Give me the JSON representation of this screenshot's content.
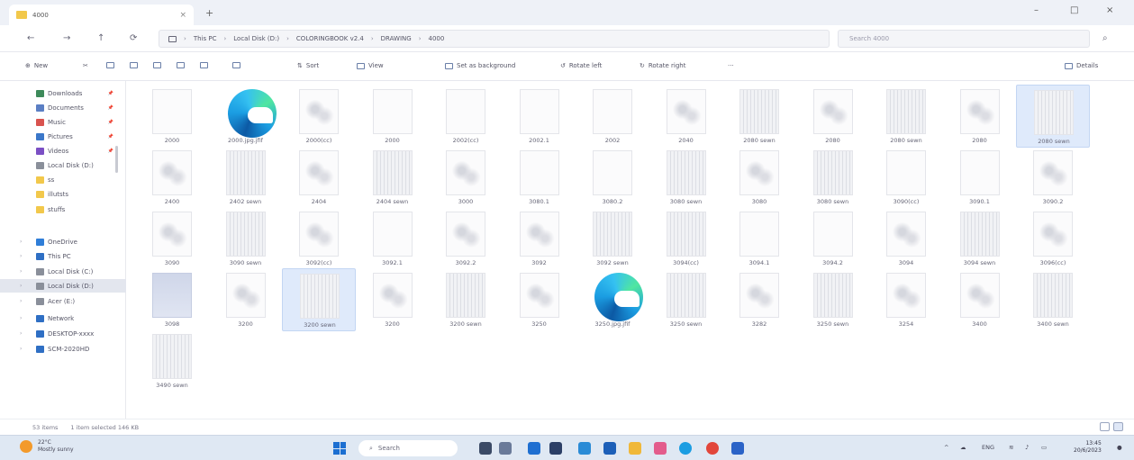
{
  "tab": {
    "title": "4000",
    "close": "×",
    "new": "+"
  },
  "window_controls": {
    "minimize": "–",
    "maximize": "□",
    "close": "×"
  },
  "nav": {
    "back": "←",
    "forward": "→",
    "up": "↑",
    "refresh": "⟳"
  },
  "address": {
    "crumbs": [
      "This PC",
      "Local Disk (D:)",
      "COLORINGBOOK v2.4",
      "DRAWING",
      "4000"
    ],
    "separator": "›"
  },
  "search": {
    "placeholder": "Search 4000"
  },
  "commands": {
    "new": "New",
    "sort": "Sort",
    "view": "View",
    "set_background": "Set as background",
    "rotate_left": "Rotate left",
    "rotate_right": "Rotate right",
    "more": "···",
    "details": "Details"
  },
  "sidebar": {
    "items": [
      {
        "label": "Downloads",
        "pinned": true,
        "color": "#3d8a5a"
      },
      {
        "label": "Documents",
        "pinned": true,
        "color": "#5b7fc4"
      },
      {
        "label": "Music",
        "pinned": true,
        "color": "#d9534f"
      },
      {
        "label": "Pictures",
        "pinned": true,
        "color": "#3b77c9"
      },
      {
        "label": "Videos",
        "pinned": true,
        "color": "#7b4fc4"
      },
      {
        "label": "Local Disk (D:)",
        "pinned": false,
        "color": "#8a8f9a"
      },
      {
        "label": "ss",
        "pinned": false,
        "color": "#f2c84b"
      },
      {
        "label": "illutsts",
        "pinned": false,
        "color": "#f2c84b"
      },
      {
        "label": "stuffs",
        "pinned": false,
        "color": "#f2c84b"
      },
      {
        "label": "OneDrive",
        "pinned": false,
        "color": "#2f7ed8"
      },
      {
        "label": "This PC",
        "pinned": false,
        "color": "#2f6fc4"
      },
      {
        "label": "Local Disk (C:)",
        "pinned": false,
        "color": "#8a8f9a"
      },
      {
        "label": "Local Disk (D:)",
        "pinned": false,
        "color": "#8a8f9a"
      },
      {
        "label": "Acer (E:)",
        "pinned": false,
        "color": "#8a8f9a"
      },
      {
        "label": "Network",
        "pinned": false,
        "color": "#2f6fc4"
      },
      {
        "label": "DESKTOP-xxxx",
        "pinned": false,
        "color": "#2f6fc4"
      },
      {
        "label": "SCM-2020HD",
        "pinned": false,
        "color": "#2f6fc4"
      }
    ],
    "pin_glyph": "📌"
  },
  "files": [
    {
      "name": "2000",
      "kind": "plain"
    },
    {
      "name": "2000.jpg.jfif",
      "kind": "edge"
    },
    {
      "name": "2000(cc)",
      "kind": "sketch"
    },
    {
      "name": "2000",
      "kind": "plain"
    },
    {
      "name": "2002(cc)",
      "kind": "plain"
    },
    {
      "name": "2002.1",
      "kind": "plain"
    },
    {
      "name": "2002",
      "kind": "plain"
    },
    {
      "name": "2040",
      "kind": "sketch"
    },
    {
      "name": "2080 sewn",
      "kind": "lines"
    },
    {
      "name": "2080",
      "kind": "sketch"
    },
    {
      "name": "2080 sewn",
      "kind": "lines"
    },
    {
      "name": "2080",
      "kind": "sketch"
    },
    {
      "name": "2080 sewn",
      "kind": "lines"
    },
    {
      "name": "2400",
      "kind": "sketch"
    },
    {
      "name": "2402 sewn",
      "kind": "lines"
    },
    {
      "name": "2404",
      "kind": "sketch"
    },
    {
      "name": "2404 sewn",
      "kind": "lines"
    },
    {
      "name": "3000",
      "kind": "sketch"
    },
    {
      "name": "3080.1",
      "kind": "plain"
    },
    {
      "name": "3080.2",
      "kind": "plain"
    },
    {
      "name": "3080 sewn",
      "kind": "lines"
    },
    {
      "name": "3080",
      "kind": "sketch"
    },
    {
      "name": "3080 sewn",
      "kind": "lines"
    },
    {
      "name": "3090(cc)",
      "kind": "plain"
    },
    {
      "name": "3090.1",
      "kind": "plain"
    },
    {
      "name": "3090.2",
      "kind": "sketch"
    },
    {
      "name": "3090",
      "kind": "sketch"
    },
    {
      "name": "3090 sewn",
      "kind": "lines"
    },
    {
      "name": "3092(cc)",
      "kind": "sketch"
    },
    {
      "name": "3092.1",
      "kind": "plain"
    },
    {
      "name": "3092.2",
      "kind": "sketch"
    },
    {
      "name": "3092",
      "kind": "sketch"
    },
    {
      "name": "3092 sewn",
      "kind": "lines"
    },
    {
      "name": "3094(cc)",
      "kind": "lines"
    },
    {
      "name": "3094.1",
      "kind": "plain"
    },
    {
      "name": "3094.2",
      "kind": "plain"
    },
    {
      "name": "3094",
      "kind": "sketch"
    },
    {
      "name": "3094 sewn",
      "kind": "lines"
    },
    {
      "name": "3096(cc)",
      "kind": "sketch"
    },
    {
      "name": "3098",
      "kind": "blue"
    },
    {
      "name": "3200",
      "kind": "sketch"
    },
    {
      "name": "3200 sewn",
      "kind": "lines"
    },
    {
      "name": "3200",
      "kind": "sketch"
    },
    {
      "name": "3200 sewn",
      "kind": "lines"
    },
    {
      "name": "3250",
      "kind": "sketch"
    },
    {
      "name": "3250.jpg.jfif",
      "kind": "edge"
    },
    {
      "name": "3250 sewn",
      "kind": "lines"
    },
    {
      "name": "3282",
      "kind": "sketch"
    },
    {
      "name": "3250 sewn",
      "kind": "lines"
    },
    {
      "name": "3254",
      "kind": "sketch"
    },
    {
      "name": "3400",
      "kind": "sketch"
    },
    {
      "name": "3400 sewn",
      "kind": "lines"
    },
    {
      "name": "3490 sewn",
      "kind": "lines"
    }
  ],
  "status": {
    "count": "53 items",
    "selection": "1 item selected  146 KB"
  },
  "taskbar": {
    "weather_temp": "22°C",
    "weather_desc": "Mostly sunny",
    "search": "Search",
    "tray_text": "ENG",
    "time": "13:45",
    "date": "20/6/2023"
  }
}
